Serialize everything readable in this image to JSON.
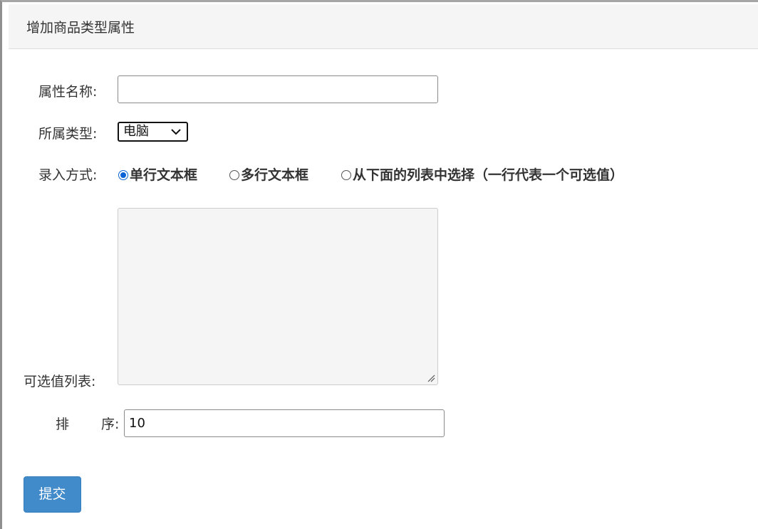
{
  "panel": {
    "title": "增加商品类型属性"
  },
  "form": {
    "name_label": "属性名称:",
    "name_value": "",
    "type_label": "所属类型:",
    "type_selected": "电脑",
    "input_mode_label": "录入方式:",
    "input_modes": [
      {
        "label": "单行文本框",
        "checked": true
      },
      {
        "label": "多行文本框",
        "checked": false
      },
      {
        "label": "从下面的列表中选择（一行代表一个可选值）",
        "checked": false
      }
    ],
    "options_label": "可选值列表:",
    "options_value": "",
    "sort_label_char1": "排",
    "sort_label_char2": "序:",
    "sort_value": "10",
    "submit_label": "提交"
  },
  "colors": {
    "heading_bg": "#f5f5f5",
    "button_bg": "#428bca",
    "radio_checked": "#0a63d6"
  },
  "icons": {
    "select_arrow": "chevron-down-icon",
    "textarea_grip": "resize-grip-icon"
  }
}
